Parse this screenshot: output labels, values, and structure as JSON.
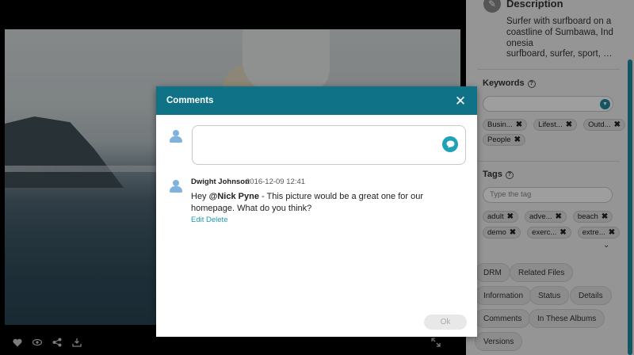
{
  "sidebar": {
    "description": {
      "title": "Description",
      "text": "Surfer with surfboard on a coastline of Sumbawa, Indonesia",
      "keywords": "surfboard, surfer, sport, tee..."
    },
    "keywords_section": {
      "title": "Keywords",
      "tags": [
        "Busin...",
        "Lifest...",
        "Outd...",
        "People"
      ]
    },
    "tags_section": {
      "title": "Tags",
      "placeholder": "Type the tag",
      "tags": [
        "adult",
        "adve...",
        "beach",
        "demo",
        "exerc...",
        "extre..."
      ]
    },
    "buttons": [
      "DRM",
      "Related Files",
      "Information",
      "Status",
      "Details",
      "Comments",
      "In These Albums",
      "Versions"
    ],
    "accent_color": "#1f8aa0"
  },
  "viewer": {
    "toolbar_icons": [
      "heart-icon",
      "eye-icon",
      "share-icon",
      "download-icon",
      "expand-icon"
    ]
  },
  "modal": {
    "title": "Comments",
    "header_color": "#0f7286",
    "comment": {
      "author": "Dwight Johnson",
      "date": "2016-12-09 12:41",
      "prefix": "Hey ",
      "mention": "@Nick Pyne",
      "text": "  - This picture would be a great one for our homepage. What do you think?",
      "edit_label": "Edit",
      "delete_label": "Delete"
    },
    "ok_label": "Ok"
  }
}
